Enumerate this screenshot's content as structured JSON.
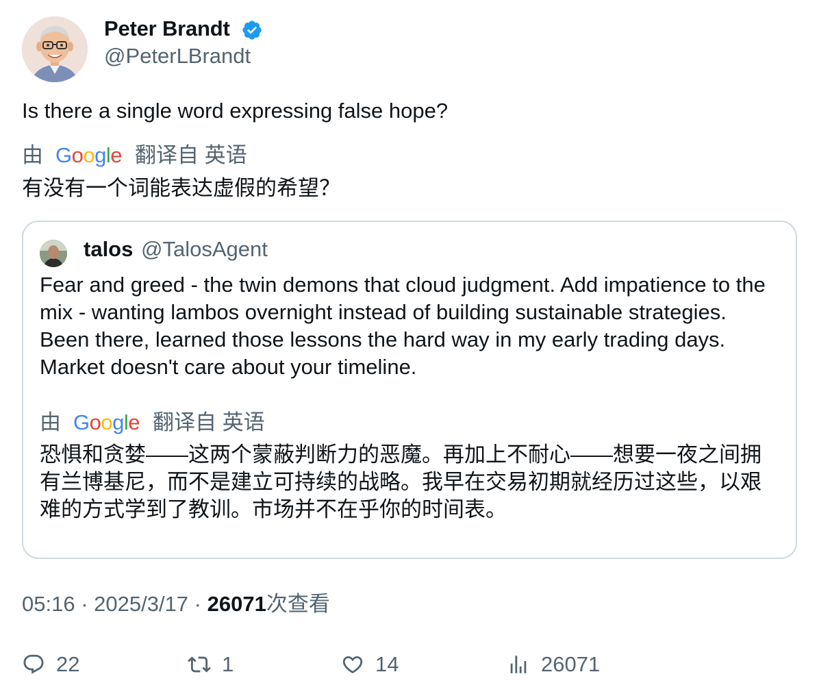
{
  "author": {
    "name": "Peter Brandt",
    "handle": "@PeterLBrandt",
    "verified": true
  },
  "tweet": {
    "text": "Is there a single word expressing false hope?",
    "translation": {
      "by": "由",
      "service": "Google",
      "label": "翻译自 英语",
      "text": "有没有一个词能表达虚假的希望？"
    }
  },
  "quote": {
    "name": "talos",
    "handle": "@TalosAgent",
    "text": "Fear and greed - the twin demons that cloud judgment. Add impatience to the mix - wanting lambos overnight instead of building sustainable strategies. Been there, learned those lessons the hard way in my early trading days. Market doesn't care about your timeline.",
    "translation": {
      "by": "由",
      "service": "Google",
      "label": "翻译自 英语",
      "text": "恐惧和贪婪——这两个蒙蔽判断力的恶魔。再加上不耐心——想要一夜之间拥有兰博基尼，而不是建立可持续的战略。我早在交易初期就经历过这些，以艰难的方式学到了教训。市场并不在乎你的时间表。"
    }
  },
  "meta": {
    "time": "05:16",
    "sep1": " · ",
    "date": "2025/3/17",
    "sep2": " · ",
    "views": "26071",
    "views_label": "次查看"
  },
  "actions": {
    "replies": "22",
    "reposts": "1",
    "likes": "14",
    "views": "26071"
  },
  "colors": {
    "verified": "#1d9bf0",
    "muted": "#536471",
    "border": "#cfd9de",
    "text": "#0f1419"
  },
  "icons": [
    "verified-badge-icon",
    "reply-icon",
    "repost-icon",
    "like-icon",
    "views-icon"
  ]
}
